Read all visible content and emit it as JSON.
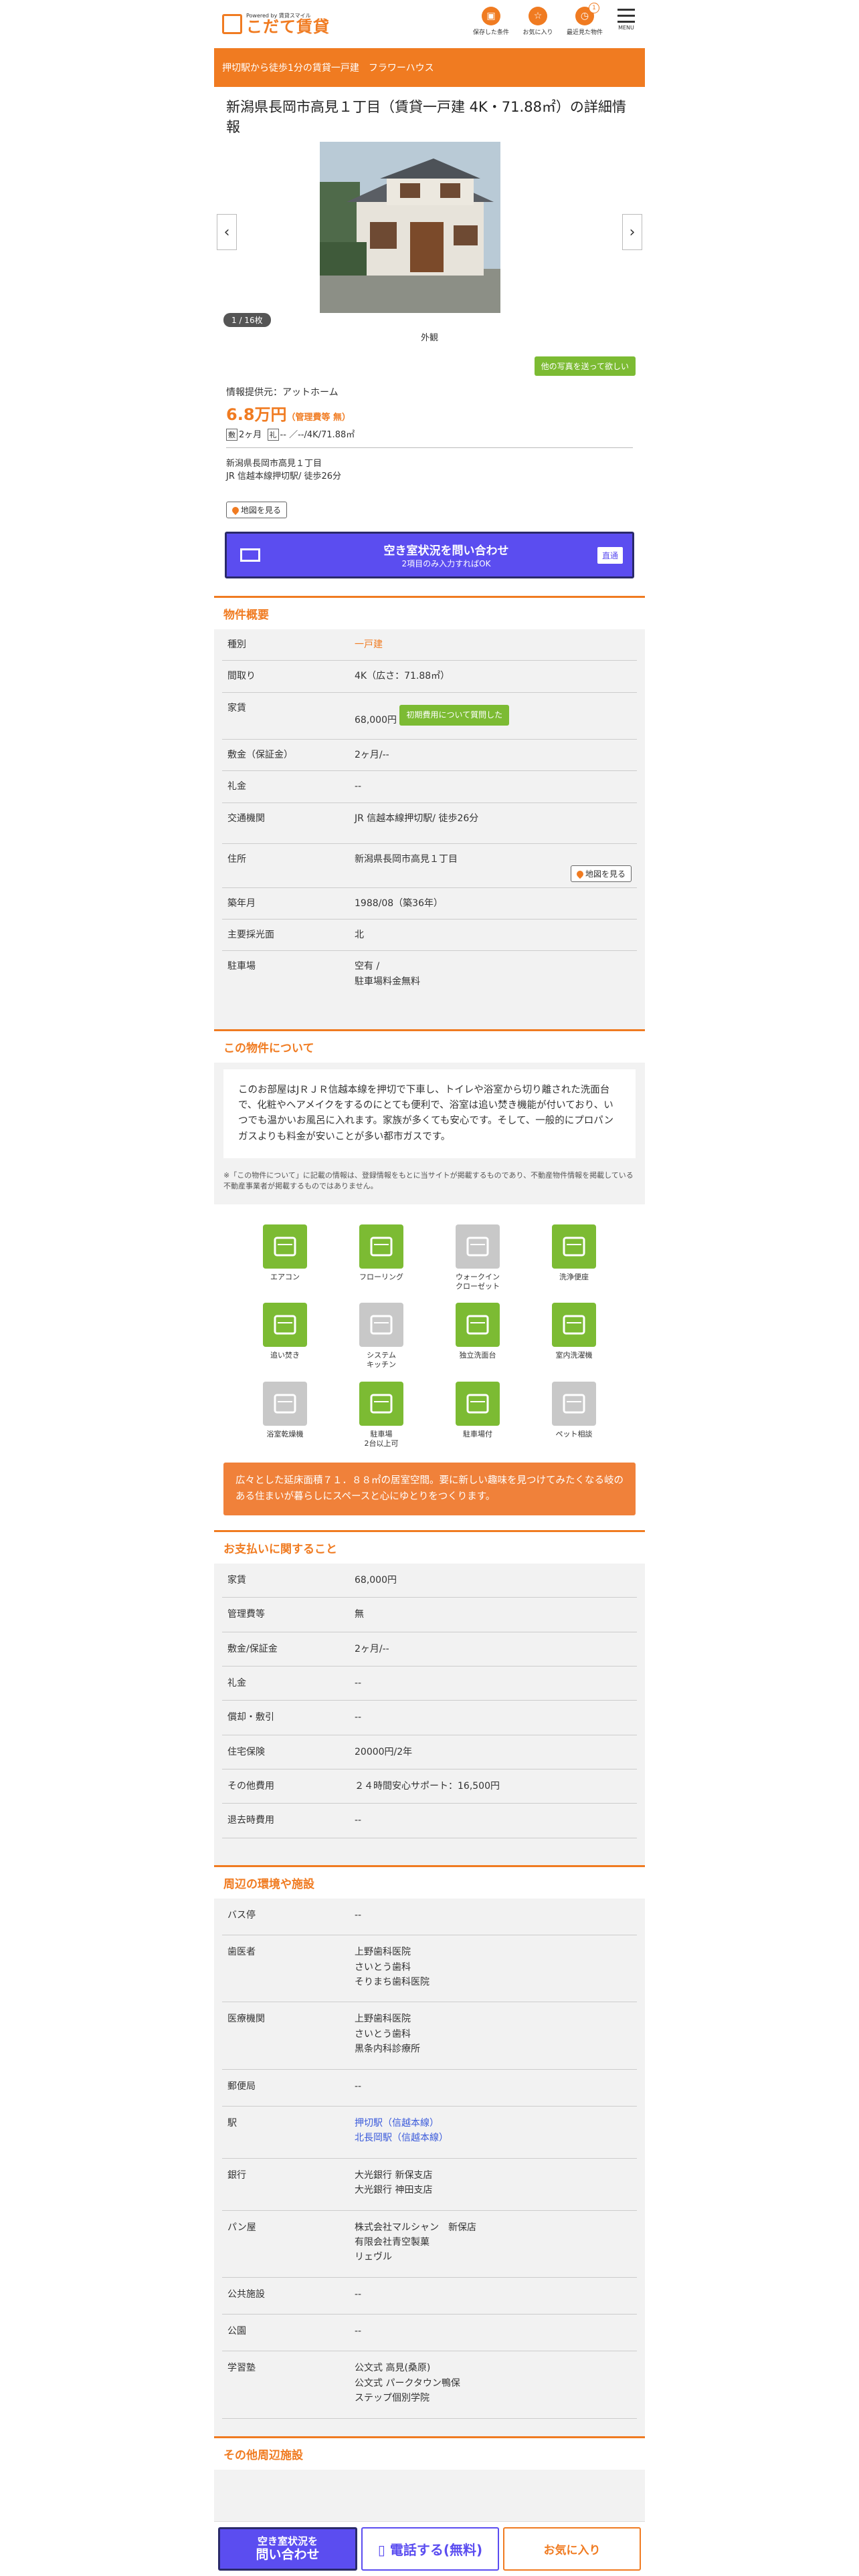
{
  "header": {
    "logo_small": "Powered by 賃貸スマイル",
    "logo_main": "こだて賃貸",
    "icons": [
      {
        "label": "保存した条件",
        "icon": "save-icon"
      },
      {
        "label": "お気に入り",
        "icon": "star-icon"
      },
      {
        "label": "最近見た物件",
        "icon": "clock-icon",
        "badge": "1"
      }
    ],
    "menu_label": "MENU"
  },
  "banner": "押切駅から徒歩1分の賃貸一戸建　フラワーハウス",
  "title": "新潟県長岡市高見１丁目（賃貸一戸建 4K・71.88㎡）の詳細情報",
  "gallery": {
    "counter": "1 / 16枚",
    "caption": "外観",
    "other_photos": "他の写真を送って欲しい"
  },
  "summary": {
    "provider": "情報提供元：アットホーム",
    "price": "6.8万円",
    "fee": "（管理費等 無）",
    "deposit_tag": "敷",
    "deposit": "2ヶ月",
    "key_tag": "礼",
    "key": "--",
    "layout": "--/4K/71.88㎡",
    "address": "新潟県長岡市高見１丁目",
    "station": "JR 信越本線押切駅/ 徒歩26分",
    "map_btn": "地図を見る"
  },
  "cta": {
    "main": "空き室状況を問い合わせ",
    "sub": "2項目のみ入力すればOK",
    "direct": "直通"
  },
  "overview": {
    "heading": "物件概要",
    "rows": [
      {
        "k": "種別",
        "v": "一戸建"
      },
      {
        "k": "間取り",
        "v": "4K（広さ：71.88㎡）"
      },
      {
        "k": "家賃",
        "v": "68,000円"
      },
      {
        "k": "敷金（保証金）",
        "v": "2ヶ月/--"
      },
      {
        "k": "礼金",
        "v": "--"
      },
      {
        "k": "交通機関",
        "v": "JR 信越本線押切駅/ 徒歩26分"
      },
      {
        "k": "住所",
        "v": "新潟県長岡市高見１丁目"
      },
      {
        "k": "築年月",
        "v": "1988/08（築36年）"
      },
      {
        "k": "主要採光面",
        "v": "北"
      },
      {
        "k": "駐車場",
        "v": "空有 /"
      },
      {
        "k": "",
        "v": "駐車場料金無料"
      }
    ],
    "initial_cost_btn": "初期費用について質問した",
    "map_btn": "地図を見る"
  },
  "about": {
    "heading": "この物件について",
    "text": "このお部屋はJＲＪＲ信越本線を押切で下車し、トイレや浴室から切り離された洗面台で、化粧やヘアメイクをするのにとても便利で、浴室は追い焚き機能が付いており、いつでも温かいお風呂に入れます。家族が多くても安心です。そして、一般的にプロパンガスよりも料金が安いことが多い都市ガスです。",
    "note": "※「この物件について」に記載の情報は、登録情報をもとに当サイトが掲載するものであり、不動産物件情報を掲載している不動産事業者が掲載するものではありません。"
  },
  "features": [
    {
      "label": "エアコン",
      "on": true,
      "icon": "aircon-icon"
    },
    {
      "label": "フローリング",
      "on": true,
      "icon": "flooring-icon"
    },
    {
      "label": "ウォークイン\nクローゼット",
      "on": false,
      "icon": "closet-icon"
    },
    {
      "label": "洗浄便座",
      "on": true,
      "icon": "toilet-icon"
    },
    {
      "label": "追い焚き",
      "on": true,
      "icon": "reheat-icon"
    },
    {
      "label": "システム\nキッチン",
      "on": false,
      "icon": "kitchen-icon"
    },
    {
      "label": "独立洗面台",
      "on": true,
      "icon": "washbasin-icon"
    },
    {
      "label": "室内洗濯機",
      "on": true,
      "icon": "washer-icon"
    },
    {
      "label": "浴室乾燥機",
      "on": false,
      "icon": "bathdryer-icon"
    },
    {
      "label": "駐車場\n2台以上可",
      "on": true,
      "icon": "car-icon"
    },
    {
      "label": "駐車場付",
      "on": true,
      "icon": "parking-icon"
    },
    {
      "label": "ペット相談",
      "on": false,
      "icon": "pet-icon"
    }
  ],
  "promo": "広々とした延床面積７１．８８㎡の居室空間。要に新しい趣味を見つけてみたくなる岐のある住まいが暮らしにスペースと心にゆとりをつくります。",
  "payment": {
    "heading": "お支払いに関すること",
    "rows": [
      {
        "k": "家賃",
        "v": "68,000円"
      },
      {
        "k": "管理費等",
        "v": "無"
      },
      {
        "k": "敷金/保証金",
        "v": "2ヶ月/--"
      },
      {
        "k": "礼金",
        "v": "--"
      },
      {
        "k": "償却・敷引",
        "v": "--"
      },
      {
        "k": "住宅保険",
        "v": "20000円/2年"
      },
      {
        "k": "その他費用",
        "v": "２４時間安心サポート：16,500円"
      },
      {
        "k": "退去時費用",
        "v": "--"
      }
    ]
  },
  "environment": {
    "heading": "周辺の環境や施設",
    "rows": [
      {
        "k": "バス停",
        "v": [
          "--"
        ]
      },
      {
        "k": "歯医者",
        "v": [
          "上野歯科医院",
          "さいとう歯科",
          "そりまち歯科医院"
        ]
      },
      {
        "k": "医療機関",
        "v": [
          "上野歯科医院",
          "さいとう歯科",
          "黒条内科診療所"
        ]
      },
      {
        "k": "郵便局",
        "v": [
          "--"
        ]
      },
      {
        "k": "駅",
        "v": [
          "押切駅（信越本線）",
          "北長岡駅（信越本線）"
        ],
        "link": true
      },
      {
        "k": "銀行",
        "v": [
          "大光銀行 新保支店",
          "大光銀行 神田支店"
        ]
      },
      {
        "k": "パン屋",
        "v": [
          "株式会社マルシャン　新保店",
          "有限会社青空製菓",
          "リェヴル"
        ]
      },
      {
        "k": "公共施設",
        "v": [
          "--"
        ]
      },
      {
        "k": "公園",
        "v": [
          "--"
        ]
      },
      {
        "k": "学習塾",
        "v": [
          "公文式 高見(桑原)",
          "公文式 パークタウン鴨保",
          "ステップ個別学院"
        ]
      }
    ]
  },
  "other_heading": "その他周辺施設",
  "bottom": {
    "inquiry_line1": "空き室状況を",
    "inquiry_line2": "問い合わせ",
    "phone": "電話する(無料)",
    "favorite": "お気に入り"
  }
}
